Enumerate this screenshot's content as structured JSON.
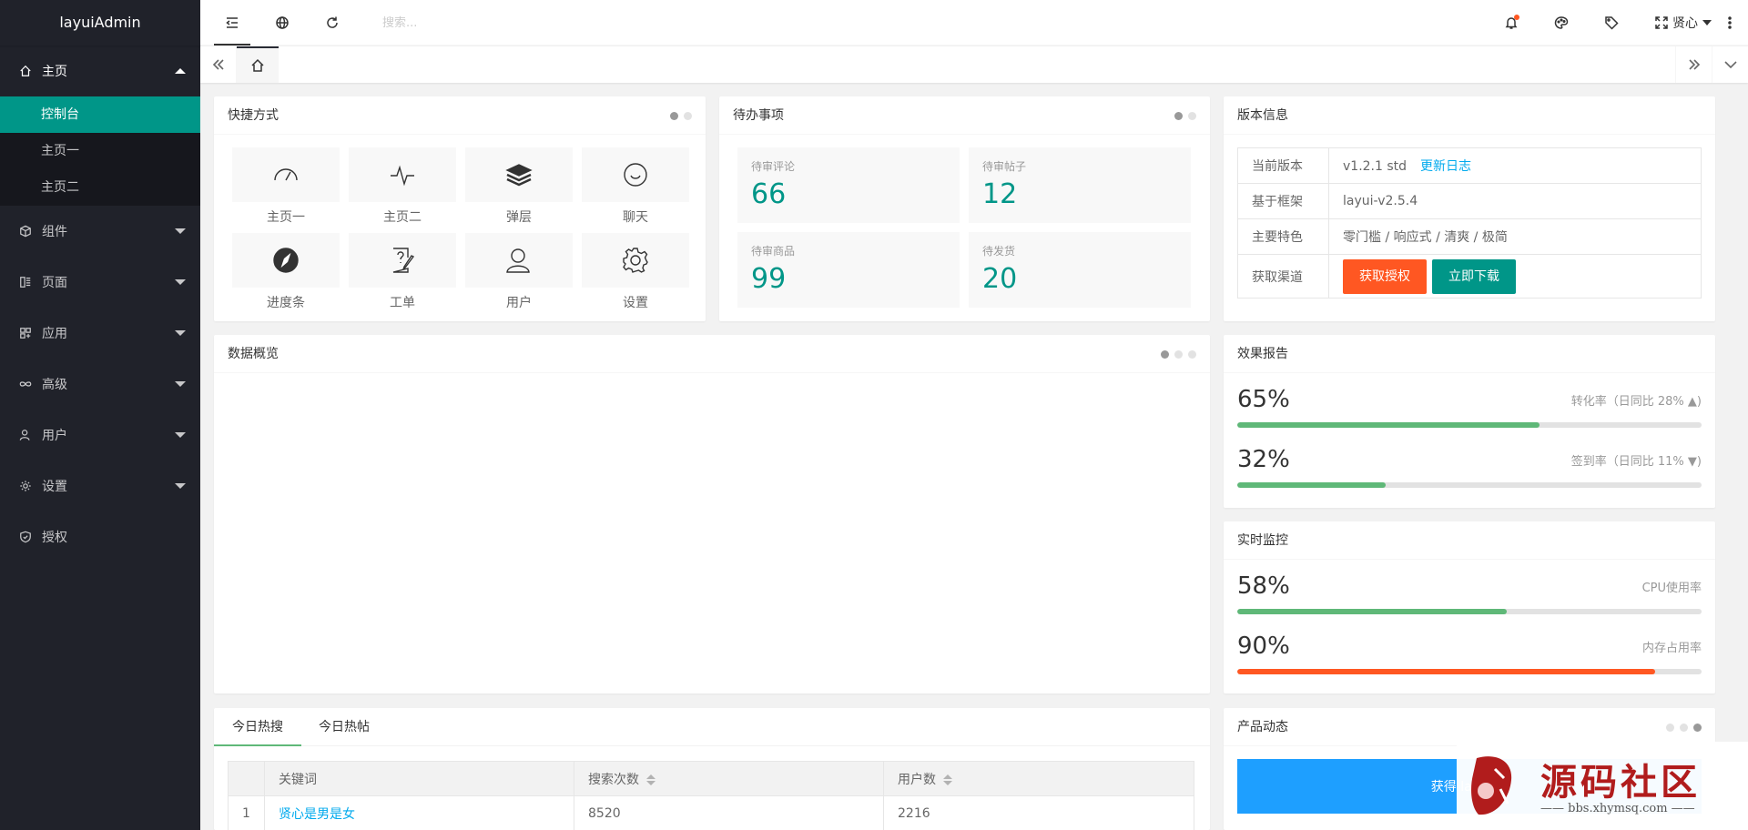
{
  "app": {
    "title": "layuiAdmin"
  },
  "sidebar": {
    "home": {
      "label": "主页",
      "icon": "home-icon"
    },
    "home_sub": [
      "控制台",
      "主页一",
      "主页二"
    ],
    "items": [
      {
        "label": "组件",
        "icon": "cube-icon"
      },
      {
        "label": "页面",
        "icon": "template-icon"
      },
      {
        "label": "应用",
        "icon": "app-icon"
      },
      {
        "label": "高级",
        "icon": "senior-icon"
      },
      {
        "label": "用户",
        "icon": "user-icon"
      },
      {
        "label": "设置",
        "icon": "set-icon"
      },
      {
        "label": "授权",
        "icon": "auz-icon"
      }
    ]
  },
  "header": {
    "search_placeholder": "搜索...",
    "user_name": "贤心"
  },
  "shortcuts": {
    "title": "快捷方式",
    "items": [
      {
        "label": "主页一",
        "icon": "console-icon"
      },
      {
        "label": "主页二",
        "icon": "chart-icon"
      },
      {
        "label": "弹层",
        "icon": "layers-icon"
      },
      {
        "label": "聊天",
        "icon": "chat-icon"
      },
      {
        "label": "进度条",
        "icon": "compass-icon"
      },
      {
        "label": "工单",
        "icon": "survey-icon"
      },
      {
        "label": "用户",
        "icon": "user-icon"
      },
      {
        "label": "设置",
        "icon": "gear-icon"
      }
    ]
  },
  "todo": {
    "title": "待办事项",
    "items": [
      {
        "label": "待审评论",
        "value": "66"
      },
      {
        "label": "待审帖子",
        "value": "12"
      },
      {
        "label": "待审商品",
        "value": "99"
      },
      {
        "label": "待发货",
        "value": "20"
      }
    ]
  },
  "version": {
    "title": "版本信息",
    "rows": [
      {
        "k": "当前版本",
        "v": "v1.2.1 std",
        "link": "更新日志"
      },
      {
        "k": "基于框架",
        "v": "layui-v2.5.4"
      },
      {
        "k": "主要特色",
        "v": "零门槛 / 响应式 / 清爽 / 极简"
      },
      {
        "k": "获取渠道"
      }
    ],
    "btn_auth": "获取授权",
    "btn_download": "立即下载"
  },
  "overview": {
    "title": "数据概览"
  },
  "report": {
    "title": "效果报告",
    "items": [
      {
        "value": "65%",
        "desc": "转化率（日同比 28%",
        "arrow": "up",
        "percent": 65,
        "color": "#5fb878"
      },
      {
        "value": "32%",
        "desc": "签到率（日同比 11%",
        "arrow": "down",
        "percent": 32,
        "color": "#5fb878"
      }
    ]
  },
  "monitor": {
    "title": "实时监控",
    "items": [
      {
        "value": "58%",
        "desc": "CPU使用率",
        "percent": 58,
        "color": "#5fb878"
      },
      {
        "value": "90%",
        "desc": "内存占用率",
        "percent": 90,
        "color": "#ff5722"
      }
    ]
  },
  "hot": {
    "tabs": [
      "今日热搜",
      "今日热帖"
    ],
    "columns": [
      "关键词",
      "搜索次数",
      "用户数"
    ],
    "rows": [
      {
        "n": "1",
        "keyword": "贤心是男是女",
        "count": "8520",
        "users": "2216"
      }
    ]
  },
  "dynamic": {
    "title": "产品动态",
    "banner": "获得 layui 官"
  },
  "watermark": {
    "brand": "源码社区",
    "url": "bbs.xhymsq.com",
    "seal": "小依"
  }
}
